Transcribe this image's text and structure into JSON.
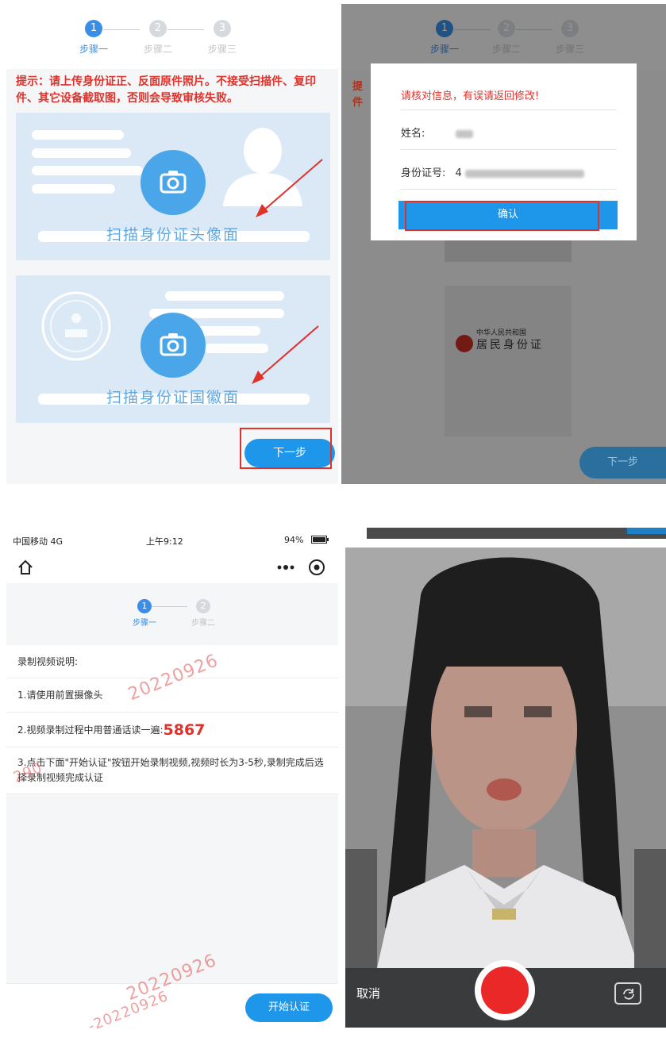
{
  "upload": {
    "steps": [
      "步骤一",
      "步骤二",
      "步骤三"
    ],
    "step_numbers": [
      "1",
      "2",
      "3"
    ],
    "tip": "提示：请上传身份证正、反面原件照片。不接受扫描件、复印件、其它设备截取图，否则会导致审核失败。",
    "front_label": "扫描身份证头像面",
    "back_label": "扫描身份证国徽面",
    "next_label": "下一步"
  },
  "confirm": {
    "steps": [
      "步骤一",
      "步骤二",
      "步骤三"
    ],
    "step_numbers": [
      "1",
      "2",
      "3"
    ],
    "bg_tip": "提\n件",
    "title": "请核对信息，有误请返回修改!",
    "name_label": "姓名:",
    "id_label": "身份证号:",
    "id_prefix": "4",
    "confirm_label": "确认",
    "id_card_header": "中华人民共和国",
    "id_card_title": "居民身份证",
    "next_label": "下一步"
  },
  "video": {
    "status": {
      "carrier": "中国移动 4G",
      "time": "上午9:12",
      "battery": "94%"
    },
    "steps": [
      "步骤一",
      "步骤二"
    ],
    "step_numbers": [
      "1",
      "2"
    ],
    "heading": "录制视频说明:",
    "item1": "1.请使用前置摄像头",
    "item2_text": "2.视频录制过程中用普通话读一遍:",
    "item2_code": "5867",
    "item3": "3.点击下面\"开始认证\"按钮开始录制视频,视频时长为3-5秒,录制完成后选择录制视频完成认证",
    "start_label": "开始认证",
    "watermarks": [
      "20220926",
      "290",
      "20220926",
      "-20220926"
    ]
  },
  "camera": {
    "cancel_label": "取消"
  },
  "colors": {
    "primary": "#1e97ea",
    "warning": "#e0312b",
    "card_bg": "#dbe9f7",
    "record": "#ea2828"
  }
}
